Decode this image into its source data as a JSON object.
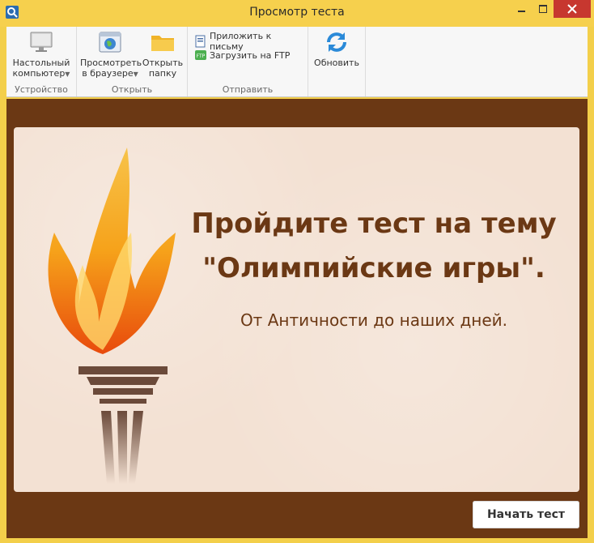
{
  "window": {
    "title": "Просмотр теста"
  },
  "ribbon": {
    "device_group": {
      "label": "Устройство",
      "desktop_line1": "Настольный",
      "desktop_line2": "компьютер"
    },
    "open_group": {
      "label": "Открыть",
      "browser_line1": "Просмотреть",
      "browser_line2": "в браузере",
      "folder_line1": "Открыть",
      "folder_line2": "папку"
    },
    "send_group": {
      "label": "Отправить",
      "attach": "Приложить к письму",
      "ftp": "Загрузить на FTP"
    },
    "refresh": {
      "label": "Обновить"
    }
  },
  "slide": {
    "headline_line1": "Пройдите тест на тему",
    "headline_line2": "\"Олимпийские игры\".",
    "subtitle": "От Античности до наших дней."
  },
  "start_button": {
    "label": "Начать тест"
  },
  "colors": {
    "titlebar": "#f6d04d",
    "frame": "#6b3814",
    "slide_bg": "#f3e1d3",
    "close": "#c7372f"
  }
}
